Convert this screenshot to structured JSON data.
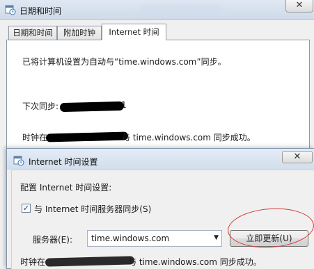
{
  "main_window": {
    "title": "日期和时间",
    "close_label": "✕",
    "tabs": [
      {
        "label": "日期和时间"
      },
      {
        "label": "附加时钟"
      },
      {
        "label": "Internet 时间"
      }
    ],
    "active_tab": 2,
    "panel": {
      "sync_status": "已将计算机设置为自动与“time.windows.com”同步。",
      "next_sync_label": "下次同步:",
      "next_sync_tail": "1",
      "clock_prefix": "时钟在",
      "clock_suffix": "与 time.windows.com 同步成功。"
    }
  },
  "dialog": {
    "title": "Internet 时间设置",
    "close_label": "✕",
    "configure_label": "配置 Internet 时间设置:",
    "sync_checkbox_label": "与 Internet 时间服务器同步(S)",
    "sync_checked": true,
    "server_label": "服务器(E):",
    "server_value": "time.windows.com",
    "update_button_label": "立即更新(U)",
    "status_prefix": "时钟在",
    "status_suffix": "与 time.windows.com 同步成功。"
  },
  "annotation": {
    "ellipse_color": "#d43a3a"
  }
}
